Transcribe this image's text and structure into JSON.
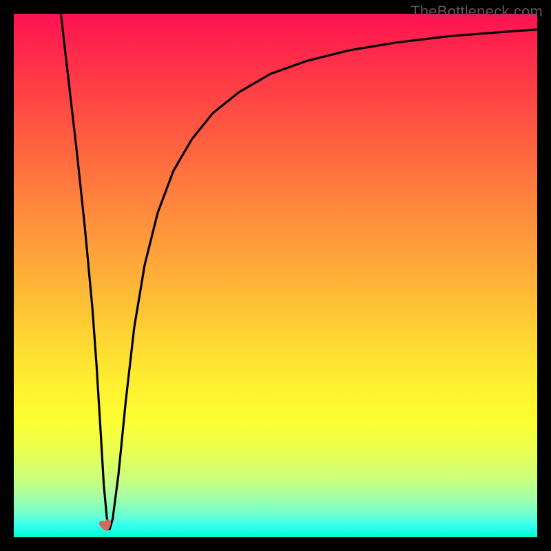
{
  "watermark": "TheBottleneck.com",
  "chart_data": {
    "type": "line",
    "title": "",
    "xlabel": "",
    "ylabel": "",
    "xlim": [
      0,
      100
    ],
    "ylim": [
      0,
      100
    ],
    "series": [
      {
        "name": "bottleneck-curve",
        "x": [
          9.0,
          10.5,
          12.0,
          13.5,
          15.0,
          15.8,
          16.6,
          17.2,
          17.8,
          18.3,
          18.9,
          20.0,
          21.4,
          23.0,
          25.0,
          27.5,
          30.5,
          34.0,
          38.0,
          43.0,
          49.0,
          56.0,
          64.0,
          73.0,
          83.0,
          93.0,
          100.0
        ],
        "y": [
          100,
          87,
          74,
          60,
          44,
          33,
          20,
          10,
          3.5,
          1.5,
          3.5,
          12,
          26,
          40,
          52,
          62,
          70,
          76,
          81,
          85,
          88.5,
          91,
          93,
          94.5,
          95.7,
          96.5,
          97
        ]
      }
    ],
    "marker": {
      "x": 17.8,
      "y": 2.0,
      "name": "heart-marker"
    },
    "background_gradient": {
      "stops": [
        {
          "pos": 0,
          "color": "#ff1252"
        },
        {
          "pos": 50,
          "color": "#ffa83a"
        },
        {
          "pos": 78,
          "color": "#fcff33"
        },
        {
          "pos": 100,
          "color": "#00ffcf"
        }
      ]
    }
  }
}
